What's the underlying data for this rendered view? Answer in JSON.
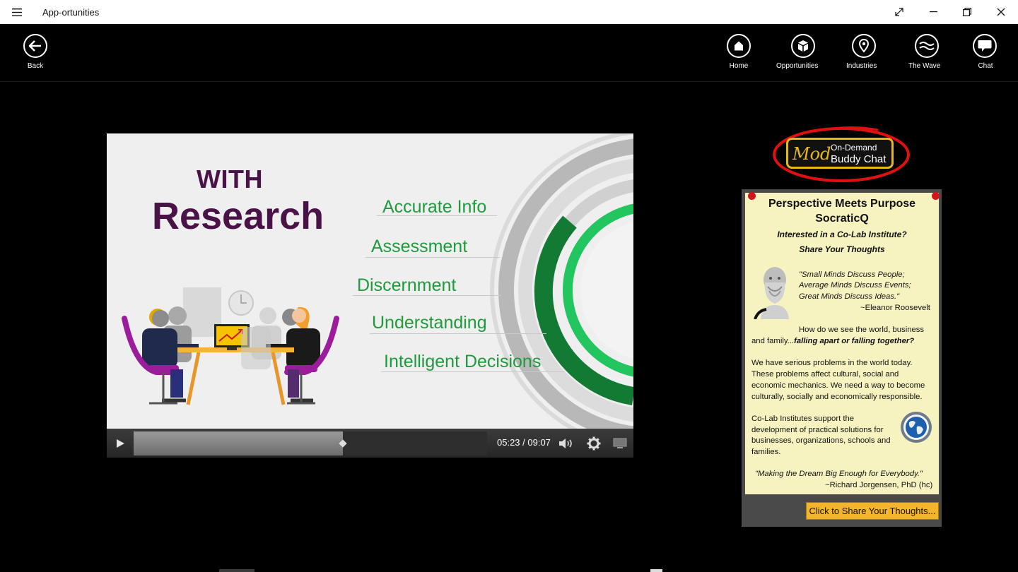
{
  "app": {
    "title": "App-ortunities"
  },
  "nav": {
    "back": "Back",
    "items": [
      {
        "label": "Home",
        "icon": "home-icon"
      },
      {
        "label": "Opportunities",
        "icon": "box-icon"
      },
      {
        "label": "Industries",
        "icon": "map-pin-icon"
      },
      {
        "label": "The Wave",
        "icon": "wave-icon"
      },
      {
        "label": "Chat",
        "icon": "chat-bubble-icon"
      }
    ]
  },
  "video": {
    "heading_small": "WITH",
    "heading_large": "Research",
    "items": [
      "Accurate Info",
      "Assessment",
      "Discernment",
      "Understanding",
      "Intelligent Decisions"
    ],
    "time": "05:23 / 09:07",
    "progress": 0.5913,
    "colors": {
      "heading": "#4a1347",
      "items": "#1f9a3d",
      "ring": "#22c55e"
    }
  },
  "buddy_chat": {
    "mod": "Mod",
    "on_demand": "On-Demand",
    "buddy_chat": "Buddy Chat"
  },
  "card": {
    "title_line1": "Perspective Meets Purpose",
    "title_line2": "SocraticQ",
    "subtitle_line1": "Interested in a Co-Lab Institute?",
    "subtitle_line2": "Share Your Thoughts",
    "quote1": [
      "\"Small Minds Discuss People;",
      "Average Minds Discuss Events;",
      "Great Minds Discuss Ideas.\""
    ],
    "quote1_author": "~Eleanor Roosevelt",
    "para1_a": "How do we see the world, business",
    "para1_b": "and family...",
    "para1_c": "falling apart or falling together?",
    "para2": [
      "We have serious problems in the world today.",
      "These problems affect cultural, social and",
      "economic mechanics. We need a way to become",
      "culturally, socially and economically responsible."
    ],
    "para3": [
      "Co-Lab Institutes support the",
      "development of practical solutions for",
      "businesses, organizations, schools and",
      "families."
    ],
    "quote2": "\"Making the Dream Big Enough for Everybody.\"",
    "quote2_author": "~Richard Jorgensen, PhD (hc)",
    "button": "Click to Share Your Thoughts..."
  }
}
